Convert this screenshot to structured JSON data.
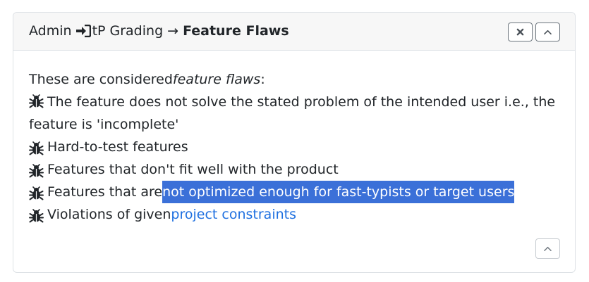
{
  "header": {
    "breadcrumb_root": "Admin",
    "breadcrumb_section": "tP Grading",
    "arrow": "→",
    "current": "Feature Flaws",
    "icons": [
      "sign-in-icon",
      "close-icon",
      "chevron-up-icon"
    ]
  },
  "body": {
    "intro_prefix": "These are considered ",
    "intro_em": "feature flaws",
    "intro_suffix": ":",
    "items": [
      {
        "text": "The feature does not solve the stated problem of the intended user i.e., the feature is 'incomplete'"
      },
      {
        "text": "Hard-to-test features"
      },
      {
        "text": "Features that don't fit well with the product"
      },
      {
        "text": "Features that are ",
        "highlight": "not optimized enough for fast-typists or target users"
      },
      {
        "text": "Violations of given ",
        "link": "project constraints"
      }
    ],
    "item_icon": "bug-icon"
  },
  "colors": {
    "link": "#1f70e0",
    "selection": "#3b70d8"
  }
}
